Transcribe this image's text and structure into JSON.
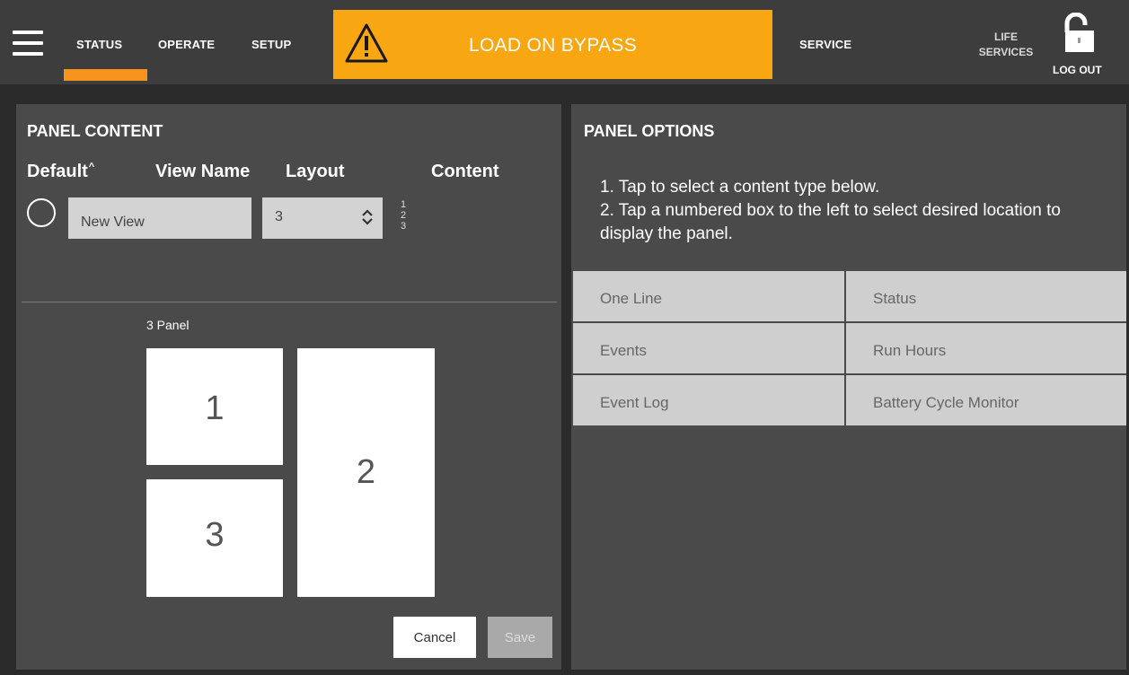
{
  "topbar": {
    "tabs": [
      {
        "label": "STATUS",
        "active": true
      },
      {
        "label": "OPERATE",
        "active": false
      },
      {
        "label": "SETUP",
        "active": false
      }
    ],
    "accent_color": "#f7941d",
    "alert": {
      "text": "LOAD ON BYPASS",
      "icon": "warning-icon",
      "color": "#f9a613"
    },
    "service_label": "SERVICE",
    "life_services_line1": "LIFE",
    "life_services_line2": "SERVICES",
    "logout_label": "LOG OUT",
    "lock_icon": "unlocked-padlock-icon"
  },
  "panel_content": {
    "title": "PANEL CONTENT",
    "headers": {
      "default": "Default",
      "sort_indicator": "^",
      "view_name": "View Name",
      "layout": "Layout",
      "content": "Content"
    },
    "row": {
      "selected": false,
      "view_name_value": "New View",
      "layout_value": "3",
      "content_slots": [
        "1",
        "2",
        "3"
      ]
    },
    "layout_preview": {
      "caption": "3 Panel",
      "slots": [
        "1",
        "2",
        "3"
      ]
    },
    "buttons": {
      "cancel": "Cancel",
      "save": "Save",
      "save_enabled": false
    }
  },
  "panel_options": {
    "title": "PANEL OPTIONS",
    "instructions": [
      "1. Tap to select a content type below.",
      "2. Tap a numbered box to the left to select desired location to display the panel."
    ],
    "content_types": [
      [
        "One Line",
        "Status"
      ],
      [
        "Events",
        "Run Hours"
      ],
      [
        "Event Log",
        "Battery Cycle Monitor"
      ]
    ]
  }
}
